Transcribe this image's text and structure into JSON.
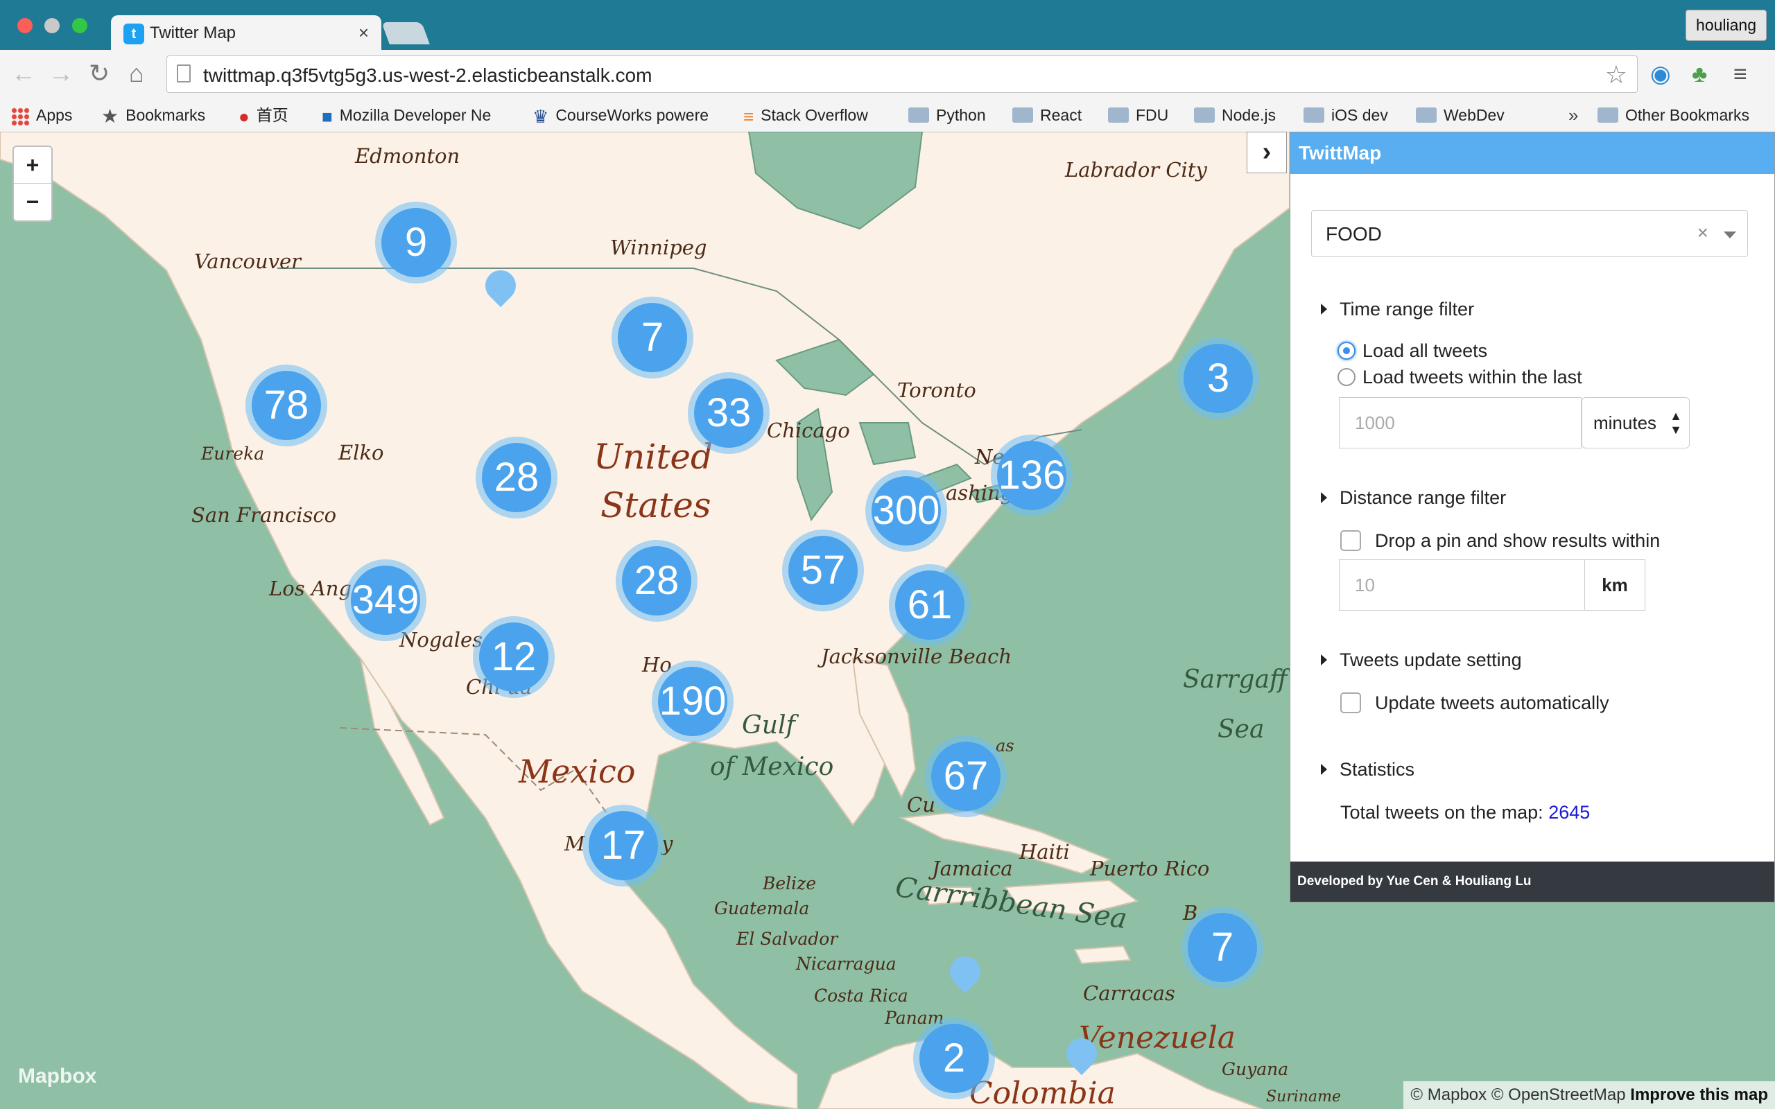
{
  "browser": {
    "tab_title": "Twitter Map",
    "url": "twittmap.q3f5vtg5g3.us-west-2.elasticbeanstalk.com",
    "user": "houliang",
    "bookmarks": [
      {
        "label": "Apps",
        "icon": "apps-grid-icon"
      },
      {
        "label": "Bookmarks",
        "icon": "star-icon"
      },
      {
        "label": "首页",
        "icon": "weibo-icon"
      },
      {
        "label": "Mozilla Developer Ne",
        "icon": "mdn-icon"
      },
      {
        "label": "CourseWorks powere",
        "icon": "crown-icon"
      },
      {
        "label": "Stack Overflow",
        "icon": "stackoverflow-icon"
      },
      {
        "label": "Python",
        "icon": "folder-icon"
      },
      {
        "label": "React",
        "icon": "folder-icon"
      },
      {
        "label": "FDU",
        "icon": "folder-icon"
      },
      {
        "label": "Node.js",
        "icon": "folder-icon"
      },
      {
        "label": "iOS dev",
        "icon": "folder-icon"
      },
      {
        "label": "WebDev",
        "icon": "folder-icon"
      }
    ],
    "more_label": "»",
    "other_bookmarks": "Other Bookmarks"
  },
  "map": {
    "zoom_in": "+",
    "zoom_out": "−",
    "places": {
      "edmonton": "Edmonton",
      "labrador_city": "Labrador City",
      "winnipeg": "Winnipeg",
      "vancouver": "Vancouver",
      "toronto": "Toronto",
      "chicago": "Chicago",
      "eureka": "Eureka",
      "elko": "Elko",
      "united": "United",
      "states": "States",
      "ne": "Ne",
      "washington": "ashingt",
      "san_francisco": "San Francisco",
      "los_angeles": "Los Ange",
      "nogales": "Nogales",
      "chihuahua": "Chi      ua",
      "ho": "Ho",
      "jacksonville": "Jacksonville Beach",
      "gulf": "Gulf",
      "of_mexico": "of Mexico",
      "mexico": "Mexico",
      "sargasso1": "Sarrgaff",
      "sargasso2": "Sea",
      "cu": "Cu",
      "as": "as",
      "m": "M",
      "y": "y",
      "haiti": "Haiti",
      "jamaica": "Jamaica",
      "puerto_rico": "Puerto Rico",
      "belize": "Belize",
      "guatemala": "Guatemala",
      "el_salvador": "El Salvador",
      "nicaragua": "Nicarragua",
      "costa_rica": "Costa Rica",
      "caribbean": "Carrribbean Sea",
      "b": "B",
      "carracas": "Carracas",
      "panama": "Panam",
      "venezuela": "Venezuela",
      "guyana": "Guyana",
      "colombia": "Colombia",
      "suriname": "Suriname"
    },
    "clusters": [
      {
        "count": "9"
      },
      {
        "count": "7"
      },
      {
        "count": "78"
      },
      {
        "count": "33"
      },
      {
        "count": "3"
      },
      {
        "count": "28"
      },
      {
        "count": "136"
      },
      {
        "count": "300"
      },
      {
        "count": "57"
      },
      {
        "count": "28"
      },
      {
        "count": "349"
      },
      {
        "count": "61"
      },
      {
        "count": "12"
      },
      {
        "count": "190"
      },
      {
        "count": "67"
      },
      {
        "count": "17"
      },
      {
        "count": "7"
      },
      {
        "count": "2"
      }
    ],
    "logo": "Mapbox",
    "attribution_mapbox": "© Mapbox",
    "attribution_osm": "© OpenStreetMap",
    "attribution_improve": "Improve this map"
  },
  "panel": {
    "title": "TwittMap",
    "topic": "FOOD",
    "topic_clear": "×",
    "time_filter": {
      "title": "Time range filter",
      "option_all": "Load all tweets",
      "option_within": "Load tweets within the last",
      "amount_placeholder": "1000",
      "unit": "minutes"
    },
    "distance_filter": {
      "title": "Distance range filter",
      "drop_pin_label": "Drop a pin and show results within",
      "distance_placeholder": "10",
      "unit": "km"
    },
    "update_setting": {
      "title": "Tweets update setting",
      "auto_label": "Update tweets automatically"
    },
    "statistics": {
      "title": "Statistics",
      "total_label": "Total tweets on the map:",
      "total_value": "2645"
    },
    "footer": "Developed by Yue Cen & Houliang Lu"
  }
}
